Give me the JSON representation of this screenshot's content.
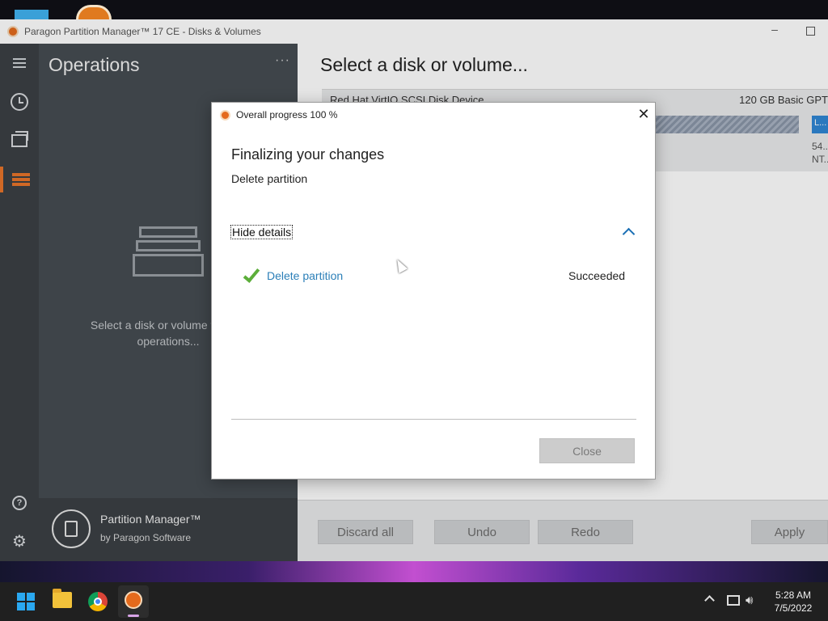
{
  "window": {
    "title": "Paragon Partition Manager™ 17 CE - Disks & Volumes"
  },
  "sidebar": {
    "title": "Operations",
    "more": "···",
    "empty_text_line1": "Select a disk or volume to view",
    "empty_text_line2": "operations...",
    "brand_name": "Partition Manager™",
    "brand_by": "by Paragon Software"
  },
  "main": {
    "title": "Select a disk or volume...",
    "disk": {
      "name": "Red Hat VirtIO SCSI Disk Device",
      "size": "120 GB Basic GPT",
      "volume_chip": "L...",
      "volume_info_1": "54...",
      "volume_info_2": "NT..."
    },
    "actions": {
      "discard": "Discard all",
      "undo": "Undo",
      "redo": "Redo",
      "apply": "Apply"
    }
  },
  "dialog": {
    "title": "Overall progress 100 %",
    "heading": "Finalizing your changes",
    "current_op": "Delete partition",
    "toggle_label": "Hide details",
    "operations": [
      {
        "label": "Delete partition",
        "status": "Succeeded"
      }
    ],
    "close_label": "Close",
    "close_x": "✕"
  },
  "taskbar": {
    "time": "5:28 AM",
    "date": "7/5/2022"
  },
  "colors": {
    "accent": "#e8742a",
    "link": "#2b7fb8",
    "success": "#5cae3a",
    "chevron": "#1a6fb5"
  }
}
